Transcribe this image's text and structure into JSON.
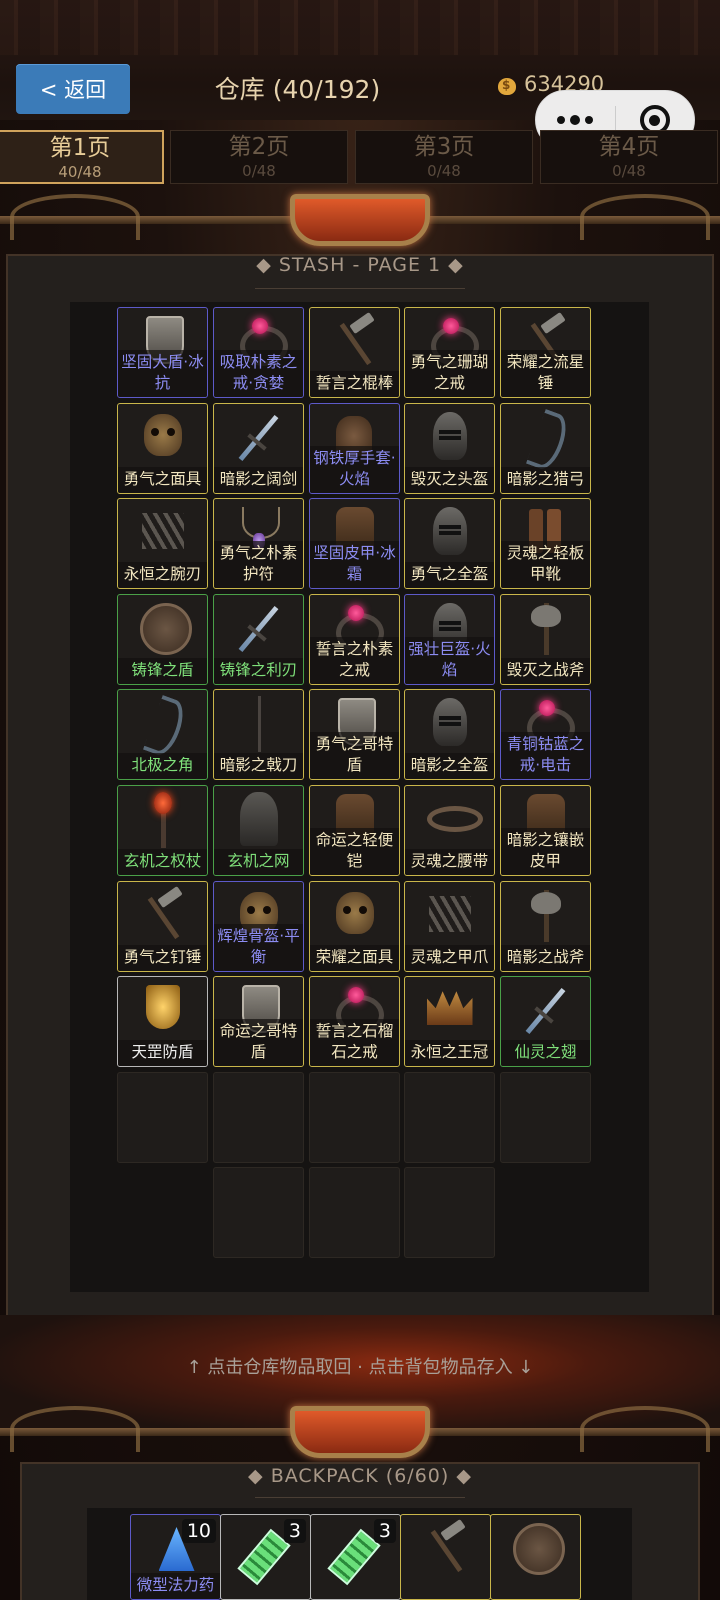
{
  "header": {
    "back_label": "< 返回",
    "title": "仓库 (40/192)",
    "gold": "634290"
  },
  "tabs": [
    {
      "label": "第1页",
      "count": "40/48"
    },
    {
      "label": "第2页",
      "count": "0/48"
    },
    {
      "label": "第3页",
      "count": "0/48"
    },
    {
      "label": "第4页",
      "count": "0/48"
    }
  ],
  "stash": {
    "label": "◆ STASH - PAGE 1 ◆",
    "items": [
      {
        "name": "坚固大盾·冰抗",
        "rarity": "blue",
        "icon": "shield-icon"
      },
      {
        "name": "吸取朴素之戒·贪婪",
        "rarity": "blue",
        "icon": "ring-icon"
      },
      {
        "name": "誓言之棍棒",
        "rarity": "yellow",
        "icon": "hammer-icon"
      },
      {
        "name": "勇气之珊瑚之戒",
        "rarity": "yellow",
        "icon": "ring-icon"
      },
      {
        "name": "荣耀之流星锤",
        "rarity": "yellow",
        "icon": "hammer-icon"
      },
      {
        "name": "勇气之面具",
        "rarity": "yellow",
        "icon": "skull-icon"
      },
      {
        "name": "暗影之阔剑",
        "rarity": "yellow",
        "icon": "sword-icon"
      },
      {
        "name": "钢铁厚手套·火焰",
        "rarity": "blue",
        "icon": "glove-icon"
      },
      {
        "name": "毁灭之头盔",
        "rarity": "yellow",
        "icon": "helm-icon"
      },
      {
        "name": "暗影之猎弓",
        "rarity": "yellow",
        "icon": "bow-icon"
      },
      {
        "name": "永恒之腕刃",
        "rarity": "yellow",
        "icon": "claw-icon"
      },
      {
        "name": "勇气之朴素护符",
        "rarity": "yellow",
        "icon": "amulet-icon"
      },
      {
        "name": "坚固皮甲·冰霜",
        "rarity": "blue",
        "icon": "armor-icon"
      },
      {
        "name": "勇气之全盔",
        "rarity": "yellow",
        "icon": "helm-icon"
      },
      {
        "name": "灵魂之轻板甲靴",
        "rarity": "yellow",
        "icon": "boots-icon"
      },
      {
        "name": "铸锋之盾",
        "rarity": "green",
        "icon": "round-shield-icon"
      },
      {
        "name": "铸锋之利刃",
        "rarity": "green",
        "icon": "sword-icon"
      },
      {
        "name": "誓言之朴素之戒",
        "rarity": "yellow",
        "icon": "ring-icon"
      },
      {
        "name": "强壮巨盔·火焰",
        "rarity": "blue",
        "icon": "helm-icon"
      },
      {
        "name": "毁灭之战斧",
        "rarity": "yellow",
        "icon": "axe-icon"
      },
      {
        "name": "北极之角",
        "rarity": "green",
        "icon": "bow-icon"
      },
      {
        "name": "暗影之戟刀",
        "rarity": "yellow",
        "icon": "spear-icon"
      },
      {
        "name": "勇气之哥特盾",
        "rarity": "yellow",
        "icon": "shield-icon"
      },
      {
        "name": "暗影之全盔",
        "rarity": "yellow",
        "icon": "helm-icon"
      },
      {
        "name": "青铜钴蓝之戒·电击",
        "rarity": "blue",
        "icon": "ring-icon"
      },
      {
        "name": "玄机之权杖",
        "rarity": "green",
        "icon": "staff-icon"
      },
      {
        "name": "玄机之网",
        "rarity": "green",
        "icon": "cloak-icon"
      },
      {
        "name": "命运之轻便铠",
        "rarity": "yellow",
        "icon": "armor-icon"
      },
      {
        "name": "灵魂之腰带",
        "rarity": "yellow",
        "icon": "belt-icon"
      },
      {
        "name": "暗影之镶嵌皮甲",
        "rarity": "yellow",
        "icon": "armor-icon"
      },
      {
        "name": "勇气之钉锤",
        "rarity": "yellow",
        "icon": "hammer-icon"
      },
      {
        "name": "辉煌骨盔·平衡",
        "rarity": "blue",
        "icon": "skull-icon"
      },
      {
        "name": "荣耀之面具",
        "rarity": "yellow",
        "icon": "skull-icon"
      },
      {
        "name": "灵魂之甲爪",
        "rarity": "yellow",
        "icon": "claw-icon"
      },
      {
        "name": "暗影之战斧",
        "rarity": "yellow",
        "icon": "axe-icon"
      },
      {
        "name": "天罡防盾",
        "rarity": "white",
        "icon": "gold-shield-icon"
      },
      {
        "name": "命运之哥特盾",
        "rarity": "yellow",
        "icon": "shield-icon"
      },
      {
        "name": "誓言之石榴石之戒",
        "rarity": "yellow",
        "icon": "ring-icon"
      },
      {
        "name": "永恒之王冠",
        "rarity": "yellow",
        "icon": "crown-icon"
      },
      {
        "name": "仙灵之翅",
        "rarity": "green",
        "icon": "sword-icon"
      }
    ]
  },
  "hint": "↑ 点击仓库物品取回 · 点击背包物品存入 ↓",
  "backpack": {
    "label": "◆ BACKPACK (6/60) ◆",
    "items": [
      {
        "name": "微型法力药",
        "count": "10",
        "rarity": "blue",
        "icon": "potion-blue-icon"
      },
      {
        "name": "",
        "count": "3",
        "rarity": "white",
        "icon": "potion-green-icon"
      },
      {
        "name": "",
        "count": "3",
        "rarity": "white",
        "icon": "potion-green-icon"
      },
      {
        "name": "",
        "count": "",
        "rarity": "yellow",
        "icon": "hammer-icon"
      },
      {
        "name": "",
        "count": "",
        "rarity": "yellow",
        "icon": "round-shield-icon"
      }
    ]
  }
}
